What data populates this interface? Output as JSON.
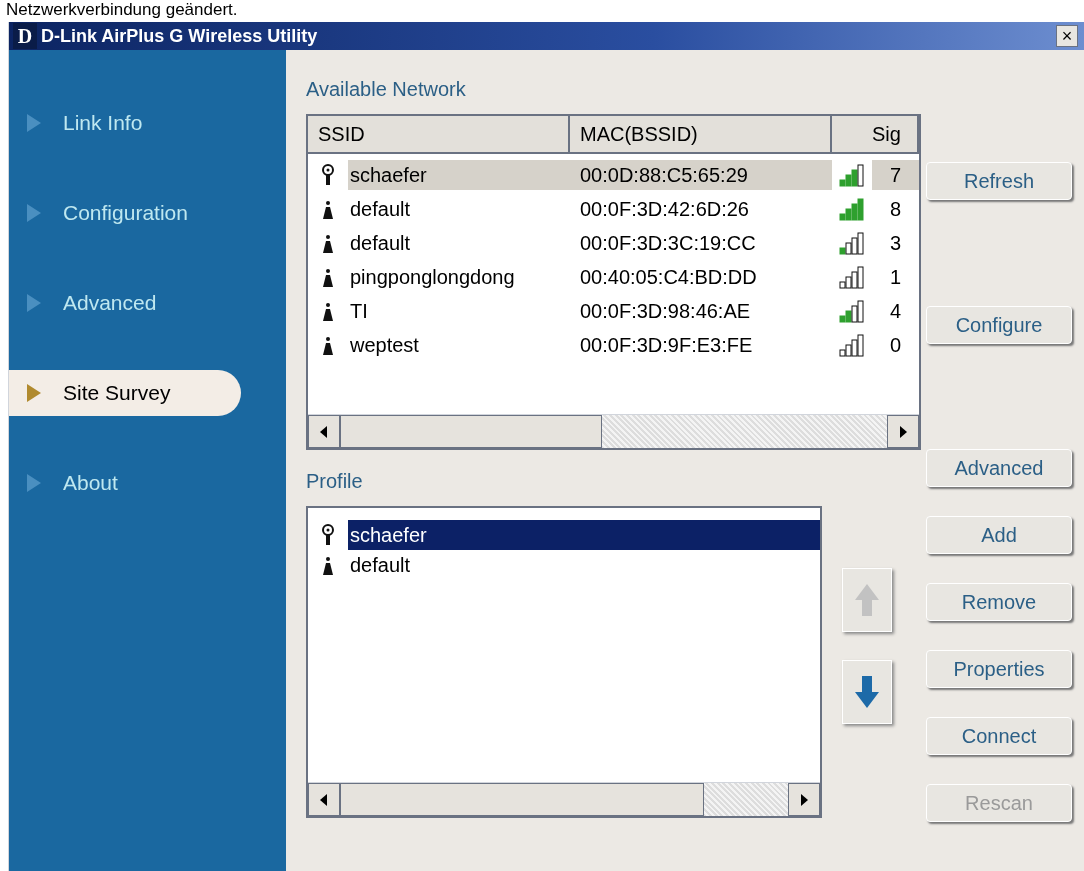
{
  "notice": "Netzwerkverbindung geändert.",
  "window": {
    "title": "D-Link AirPlus G Wireless Utility",
    "logo": "D",
    "close": "×"
  },
  "sidebar": {
    "items": [
      {
        "label": "Link Info",
        "selected": false
      },
      {
        "label": "Configuration",
        "selected": false
      },
      {
        "label": "Advanced",
        "selected": false
      },
      {
        "label": "Site Survey",
        "selected": true
      },
      {
        "label": "About",
        "selected": false
      }
    ]
  },
  "available_network": {
    "title": "Available Network",
    "columns": [
      "SSID",
      "MAC(BSSID)",
      "Sig"
    ],
    "rows": [
      {
        "kind": "connected",
        "ssid": "schaefer",
        "mac": "00:0D:88:C5:65:29",
        "signal_bars": [
          {
            "filled": true
          },
          {
            "filled": true
          },
          {
            "filled": true
          },
          {
            "filled": false
          }
        ],
        "column_3": "7",
        "selected": true
      },
      {
        "kind": "access-point",
        "ssid": "default",
        "mac": "00:0F:3D:42:6D:26",
        "signal_bars": [
          {
            "filled": true
          },
          {
            "filled": true
          },
          {
            "filled": true
          },
          {
            "filled": true
          }
        ],
        "column_3": "8",
        "selected": false
      },
      {
        "kind": "access-point",
        "ssid": "default",
        "mac": "00:0F:3D:3C:19:CC",
        "signal_bars": [
          {
            "filled": true
          },
          {
            "filled": false
          },
          {
            "filled": false
          },
          {
            "filled": false
          }
        ],
        "column_3": "3",
        "selected": false
      },
      {
        "kind": "access-point",
        "ssid": "pingponglongdong",
        "mac": "00:40:05:C4:BD:DD",
        "signal_bars": [
          {
            "filled": false
          },
          {
            "filled": false
          },
          {
            "filled": false
          },
          {
            "filled": false
          }
        ],
        "column_3": "1",
        "selected": false
      },
      {
        "kind": "access-point",
        "ssid": "TI",
        "mac": "00:0F:3D:98:46:AE",
        "signal_bars": [
          {
            "filled": true
          },
          {
            "filled": true
          },
          {
            "filled": false
          },
          {
            "filled": false
          }
        ],
        "column_3": "4",
        "selected": false
      },
      {
        "kind": "access-point",
        "ssid": "weptest",
        "mac": "00:0F:3D:9F:E3:FE",
        "signal_bars": [
          {
            "filled": false
          },
          {
            "filled": false
          },
          {
            "filled": false
          },
          {
            "filled": false
          }
        ],
        "column_3": "0",
        "selected": false
      }
    ]
  },
  "profile": {
    "title": "Profile",
    "items": [
      {
        "kind": "connected",
        "name": "schaefer",
        "selected": true
      },
      {
        "kind": "access-point",
        "name": "default",
        "selected": false
      }
    ],
    "move_up": {
      "disabled": true
    },
    "move_down": {
      "disabled": false
    }
  },
  "buttons": [
    {
      "label": "Refresh",
      "disabled": false
    },
    {
      "label": "Configure",
      "disabled": false
    },
    {
      "label": "Advanced",
      "disabled": false
    },
    {
      "label": "Add",
      "disabled": false
    },
    {
      "label": "Remove",
      "disabled": false
    },
    {
      "label": "Properties",
      "disabled": false
    },
    {
      "label": "Connect",
      "disabled": false
    },
    {
      "label": "Rescan",
      "disabled": true
    }
  ]
}
